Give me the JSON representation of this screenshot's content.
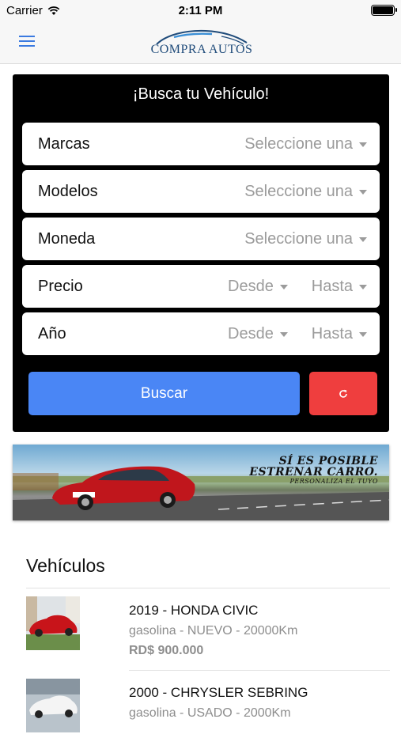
{
  "status_bar": {
    "carrier": "Carrier",
    "time": "2:11 PM"
  },
  "nav": {
    "logo_text": "COMPRA AUTOS",
    "icons": {
      "menu": "hamburger-menu-icon"
    }
  },
  "search": {
    "title": "¡Busca tu Vehículo!",
    "marcas": {
      "label": "Marcas",
      "value": "Seleccione una"
    },
    "modelos": {
      "label": "Modelos",
      "value": "Seleccione una"
    },
    "moneda": {
      "label": "Moneda",
      "value": "Seleccione una"
    },
    "precio": {
      "label": "Precio",
      "desde": "Desde",
      "hasta": "Hasta"
    },
    "anio": {
      "label": "Año",
      "desde": "Desde",
      "hasta": "Hasta"
    },
    "buscar_label": "Buscar",
    "reset_icon": "refresh-icon",
    "colors": {
      "card": "#000000",
      "buscar": "#4a86f5",
      "reset": "#ef3e3e"
    }
  },
  "banner": {
    "line1": "SÍ ES POSIBLE",
    "line2": "ESTRENAR CARRO.",
    "line3": "PERSONALIZA EL TUYO"
  },
  "vehicles": {
    "title": "Vehículos",
    "items": [
      {
        "title": "2019 - HONDA CIVIC",
        "meta": "gasolina - NUEVO - 20000Km",
        "price": "RD$ 900.000"
      },
      {
        "title": "2000 - CHRYSLER SEBRING",
        "meta": "gasolina - USADO - 2000Km",
        "price": ""
      }
    ]
  }
}
